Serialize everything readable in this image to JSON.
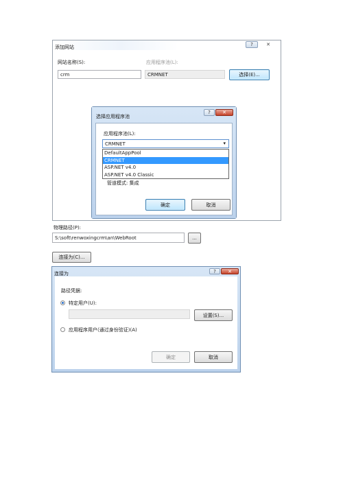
{
  "add_site": {
    "title": "添加网站",
    "help_glyph": "?",
    "close_glyph": "✕",
    "site_name_label": "网站名称(S):",
    "site_name_value": "crm",
    "app_pool_label": "应用程序池(L):",
    "app_pool_value": "CRMNET",
    "select_button": "选择(E)...",
    "physical_path_label": "物理路径(P):",
    "physical_path_value": "S:\\soft\\renwoxingcrm\\an\\WebRoot",
    "browse_button": "...",
    "connect_as_button": "连接为(C)..."
  },
  "select_pool": {
    "title": "选择应用程序池",
    "help_glyph": "?",
    "close_glyph": "✕",
    "pool_label": "应用程序池(L):",
    "selected": "CRMNET",
    "dropdown_arrow": "▾",
    "options": [
      "DefaultAppPool",
      "CRMNET",
      "ASP.NET v4.0",
      "ASP.NET v4.0 Classic"
    ],
    "highlighted_index": 1,
    "pipeline_text": "管道模式: 集成",
    "ok_button": "确定",
    "cancel_button": "取消"
  },
  "connect_as": {
    "title": "连接为",
    "help_glyph": "?",
    "close_glyph": "✕",
    "path_credentials_label": "路径凭据:",
    "specific_user_label": "特定用户(U):",
    "specific_user_selected": true,
    "set_button": "设置(S)...",
    "app_user_label": "应用程序用户(通过身份验证)(A)",
    "ok_button": "确定",
    "cancel_button": "取消"
  },
  "colors": {
    "selection_blue": "#3399ff",
    "title_glass": "#bcd2ec",
    "close_red": "#c7432a"
  }
}
